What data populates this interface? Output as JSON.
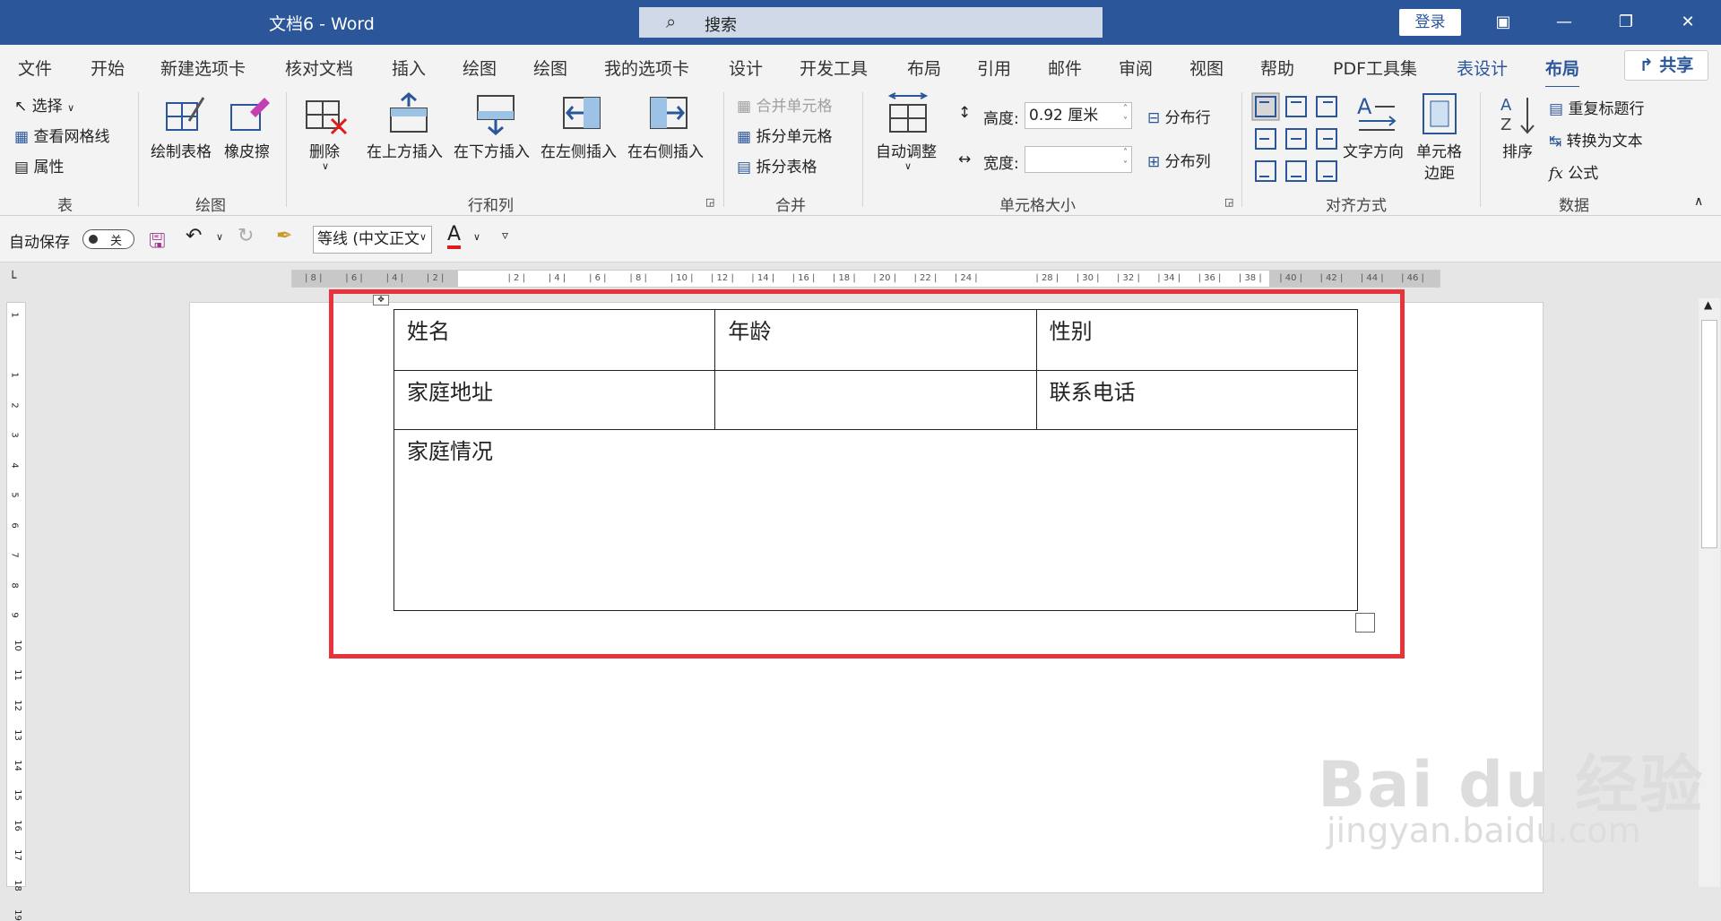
{
  "titlebar": {
    "doc_title": "文档6  -  Word",
    "search_placeholder": "搜索",
    "login_label": "登录",
    "colors": {
      "brand": "#2b579a"
    }
  },
  "tabs": [
    {
      "label": "文件"
    },
    {
      "label": "开始"
    },
    {
      "label": "新建选项卡"
    },
    {
      "label": "核对文档"
    },
    {
      "label": "插入"
    },
    {
      "label": "绘图"
    },
    {
      "label": "绘图"
    },
    {
      "label": "我的选项卡"
    },
    {
      "label": "设计"
    },
    {
      "label": "开发工具"
    },
    {
      "label": "布局"
    },
    {
      "label": "引用"
    },
    {
      "label": "邮件"
    },
    {
      "label": "审阅"
    },
    {
      "label": "视图"
    },
    {
      "label": "帮助"
    },
    {
      "label": "PDF工具集"
    },
    {
      "label": "表设计"
    },
    {
      "label": "布局"
    }
  ],
  "share_label": "共享",
  "ribbon": {
    "table_group": {
      "select": "选择",
      "gridlines": "查看网格线",
      "properties": "属性",
      "label": "表"
    },
    "draw_group": {
      "draw_table": "绘制表格",
      "eraser": "橡皮擦",
      "label": "绘图"
    },
    "rowcol_group": {
      "delete": "删除",
      "insert_above": "在上方插入",
      "insert_below": "在下方插入",
      "insert_left": "在左侧插入",
      "insert_right": "在右侧插入",
      "label": "行和列"
    },
    "merge_group": {
      "merge_cells": "合并单元格",
      "split_cells": "拆分单元格",
      "split_table": "拆分表格",
      "label": "合并"
    },
    "cellsize_group": {
      "autofit": "自动调整",
      "height_label": "高度:",
      "height_value": "0.92 厘米",
      "width_label": "宽度:",
      "width_value": "",
      "dist_rows": "分布行",
      "dist_cols": "分布列",
      "label": "单元格大小"
    },
    "align_group": {
      "text_direction": "文字方向",
      "cell_margins_1": "单元格",
      "cell_margins_2": "边距",
      "label": "对齐方式"
    },
    "data_group": {
      "sort": "排序",
      "repeat_header": "重复标题行",
      "convert_text": "转换为文本",
      "formula": "公式",
      "label": "数据"
    }
  },
  "qat": {
    "autosave_label": "自动保存",
    "autosave_state": "关",
    "font_name": "等线 (中文正文",
    "font_color": "#e01b1b"
  },
  "ruler": {
    "h_ticks": [
      "8",
      "6",
      "4",
      "2",
      "",
      "2",
      "4",
      "6",
      "8",
      "10",
      "12",
      "14",
      "16",
      "18",
      "20",
      "22",
      "24",
      "",
      "28",
      "30",
      "32",
      "34",
      "36",
      "38",
      "40",
      "42",
      "44",
      "46"
    ],
    "v_ticks": [
      "1",
      "",
      "1",
      "2",
      "3",
      "4",
      "5",
      "6",
      "7",
      "8",
      "9",
      "10",
      "11",
      "12",
      "13",
      "14",
      "15",
      "16",
      "17",
      "18",
      "19"
    ]
  },
  "document": {
    "table": {
      "rows": [
        [
          "姓名",
          "年龄",
          "性别"
        ],
        [
          "家庭地址",
          "",
          "联系电话"
        ],
        [
          "家庭情况"
        ]
      ]
    },
    "highlight_color": "#e8333a"
  },
  "watermark": {
    "line1": "Bai du 经验",
    "line2": "jingyan.baidu.com"
  }
}
